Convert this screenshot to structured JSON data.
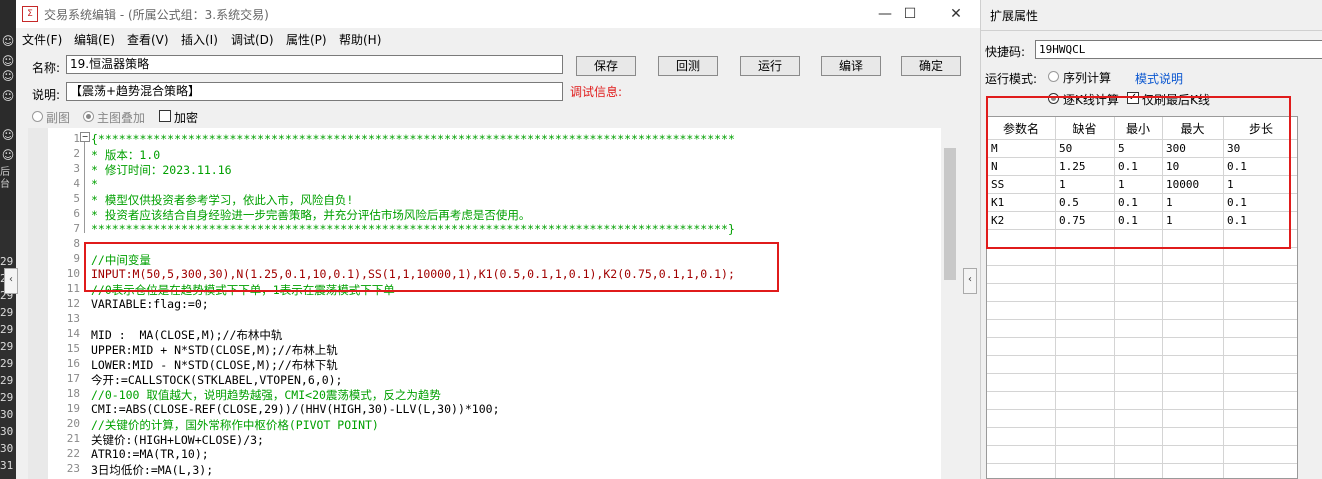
{
  "window": {
    "title": "交易系统编辑 - (所属公式组：3.系统交易)",
    "minimize": "—",
    "maximize": "☐",
    "close": "✕"
  },
  "menu": [
    "文件(F)",
    "编辑(E)",
    "查看(V)",
    "插入(I)",
    "调试(D)",
    "属性(P)",
    "帮助(H)"
  ],
  "form": {
    "name_label": "名称:",
    "name_value": "19.恒温器策略",
    "desc_label": "说明:",
    "desc_value": "【震荡+趋势混合策略】",
    "debug_label": "调试信息:",
    "buttons": [
      "保存",
      "回测",
      "运行",
      "编译",
      "确定"
    ],
    "opt_sub": "副图",
    "opt_main": "主图叠加",
    "opt_encrypt": "加密"
  },
  "editor": {
    "line_numbers": [
      "1",
      "2",
      "3",
      "4",
      "5",
      "6",
      "7",
      "8",
      "9",
      "10",
      "11",
      "12",
      "13",
      "14",
      "15",
      "16",
      "17",
      "18",
      "19",
      "20",
      "21",
      "22",
      "23"
    ],
    "lines": [
      "{********************************************************************************************",
      "* 版本：1.0",
      "* 修订时间：2023.11.16",
      "*",
      "* 模型仅供投资者参考学习，依此入市，风险自负!",
      "* 投资者应该结合自身经验进一步完善策略，并充分评估市场风险后再考虑是否使用。",
      "********************************************************************************************}",
      "",
      "//中间变量",
      "INPUT:M(50,5,300,30),N(1.25,0.1,10,0.1),SS(1,1,10000,1),K1(0.5,0.1,1,0.1),K2(0.75,0.1,1,0.1);",
      "//0表示仓位是在趋势模式下下单，1表示在震荡模式下下单",
      "VARIABLE:flag:=0;",
      "",
      "MID :  MA(CLOSE,M);//布林中轨",
      "UPPER:MID + N*STD(CLOSE,M);//布林上轨",
      "LOWER:MID - N*STD(CLOSE,M);//布林下轨",
      "今开:=CALLSTOCK(STKLABEL,VTOPEN,6,0);",
      "//0-100 取值越大，说明趋势越强，CMI<20震荡模式，反之为趋势",
      "CMI:=ABS(CLOSE-REF(CLOSE,29))/(HHV(HIGH,30)-LLV(L,30))*100;",
      "//关键价的计算，国外常称作中枢价格(PIVOT POINT)",
      "关键价:(HIGH+LOW+CLOSE)/3;",
      "ATR10:=MA(TR,10);",
      "3日均低价:=MA(L,3);"
    ]
  },
  "left_strip": {
    "labels": [
      "后台",
      "29",
      "29",
      "29",
      "29",
      "29",
      "29",
      "29",
      "29",
      "29",
      "30",
      "30",
      "30",
      "31",
      "31",
      "31"
    ]
  },
  "panel": {
    "title": "扩展属性",
    "shortcut_label": "快捷码:",
    "shortcut_value": "19HWQCL",
    "run_mode_label": "运行模式:",
    "mode_sequence": "序列计算",
    "mode_link": "模式说明",
    "mode_tick": "逐K线计算",
    "mode_last": "仅刷最后K线",
    "headers": [
      "参数名",
      "缺省",
      "最小",
      "最大",
      "步长"
    ],
    "rows": [
      [
        "M",
        "50",
        "5",
        "300",
        "30"
      ],
      [
        "N",
        "1.25",
        "0.1",
        "10",
        "0.1"
      ],
      [
        "SS",
        "1",
        "1",
        "10000",
        "1"
      ],
      [
        "K1",
        "0.5",
        "0.1",
        "1",
        "0.1"
      ],
      [
        "K2",
        "0.75",
        "0.1",
        "1",
        "0.1"
      ]
    ]
  },
  "colors": {
    "accent_red": "#e01b1b",
    "comment_green": "#00a000",
    "link_blue": "#0b57d0"
  }
}
